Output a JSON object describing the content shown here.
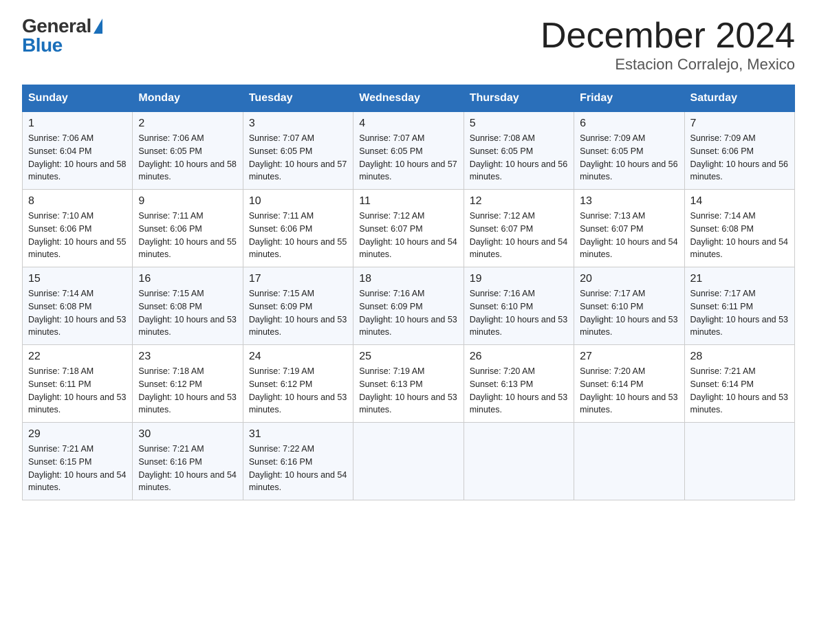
{
  "logo": {
    "general": "General",
    "blue": "Blue"
  },
  "title": "December 2024",
  "location": "Estacion Corralejo, Mexico",
  "headers": [
    "Sunday",
    "Monday",
    "Tuesday",
    "Wednesday",
    "Thursday",
    "Friday",
    "Saturday"
  ],
  "weeks": [
    [
      {
        "num": "1",
        "sunrise": "7:06 AM",
        "sunset": "6:04 PM",
        "daylight": "10 hours and 58 minutes."
      },
      {
        "num": "2",
        "sunrise": "7:06 AM",
        "sunset": "6:05 PM",
        "daylight": "10 hours and 58 minutes."
      },
      {
        "num": "3",
        "sunrise": "7:07 AM",
        "sunset": "6:05 PM",
        "daylight": "10 hours and 57 minutes."
      },
      {
        "num": "4",
        "sunrise": "7:07 AM",
        "sunset": "6:05 PM",
        "daylight": "10 hours and 57 minutes."
      },
      {
        "num": "5",
        "sunrise": "7:08 AM",
        "sunset": "6:05 PM",
        "daylight": "10 hours and 56 minutes."
      },
      {
        "num": "6",
        "sunrise": "7:09 AM",
        "sunset": "6:05 PM",
        "daylight": "10 hours and 56 minutes."
      },
      {
        "num": "7",
        "sunrise": "7:09 AM",
        "sunset": "6:06 PM",
        "daylight": "10 hours and 56 minutes."
      }
    ],
    [
      {
        "num": "8",
        "sunrise": "7:10 AM",
        "sunset": "6:06 PM",
        "daylight": "10 hours and 55 minutes."
      },
      {
        "num": "9",
        "sunrise": "7:11 AM",
        "sunset": "6:06 PM",
        "daylight": "10 hours and 55 minutes."
      },
      {
        "num": "10",
        "sunrise": "7:11 AM",
        "sunset": "6:06 PM",
        "daylight": "10 hours and 55 minutes."
      },
      {
        "num": "11",
        "sunrise": "7:12 AM",
        "sunset": "6:07 PM",
        "daylight": "10 hours and 54 minutes."
      },
      {
        "num": "12",
        "sunrise": "7:12 AM",
        "sunset": "6:07 PM",
        "daylight": "10 hours and 54 minutes."
      },
      {
        "num": "13",
        "sunrise": "7:13 AM",
        "sunset": "6:07 PM",
        "daylight": "10 hours and 54 minutes."
      },
      {
        "num": "14",
        "sunrise": "7:14 AM",
        "sunset": "6:08 PM",
        "daylight": "10 hours and 54 minutes."
      }
    ],
    [
      {
        "num": "15",
        "sunrise": "7:14 AM",
        "sunset": "6:08 PM",
        "daylight": "10 hours and 53 minutes."
      },
      {
        "num": "16",
        "sunrise": "7:15 AM",
        "sunset": "6:08 PM",
        "daylight": "10 hours and 53 minutes."
      },
      {
        "num": "17",
        "sunrise": "7:15 AM",
        "sunset": "6:09 PM",
        "daylight": "10 hours and 53 minutes."
      },
      {
        "num": "18",
        "sunrise": "7:16 AM",
        "sunset": "6:09 PM",
        "daylight": "10 hours and 53 minutes."
      },
      {
        "num": "19",
        "sunrise": "7:16 AM",
        "sunset": "6:10 PM",
        "daylight": "10 hours and 53 minutes."
      },
      {
        "num": "20",
        "sunrise": "7:17 AM",
        "sunset": "6:10 PM",
        "daylight": "10 hours and 53 minutes."
      },
      {
        "num": "21",
        "sunrise": "7:17 AM",
        "sunset": "6:11 PM",
        "daylight": "10 hours and 53 minutes."
      }
    ],
    [
      {
        "num": "22",
        "sunrise": "7:18 AM",
        "sunset": "6:11 PM",
        "daylight": "10 hours and 53 minutes."
      },
      {
        "num": "23",
        "sunrise": "7:18 AM",
        "sunset": "6:12 PM",
        "daylight": "10 hours and 53 minutes."
      },
      {
        "num": "24",
        "sunrise": "7:19 AM",
        "sunset": "6:12 PM",
        "daylight": "10 hours and 53 minutes."
      },
      {
        "num": "25",
        "sunrise": "7:19 AM",
        "sunset": "6:13 PM",
        "daylight": "10 hours and 53 minutes."
      },
      {
        "num": "26",
        "sunrise": "7:20 AM",
        "sunset": "6:13 PM",
        "daylight": "10 hours and 53 minutes."
      },
      {
        "num": "27",
        "sunrise": "7:20 AM",
        "sunset": "6:14 PM",
        "daylight": "10 hours and 53 minutes."
      },
      {
        "num": "28",
        "sunrise": "7:21 AM",
        "sunset": "6:14 PM",
        "daylight": "10 hours and 53 minutes."
      }
    ],
    [
      {
        "num": "29",
        "sunrise": "7:21 AM",
        "sunset": "6:15 PM",
        "daylight": "10 hours and 54 minutes."
      },
      {
        "num": "30",
        "sunrise": "7:21 AM",
        "sunset": "6:16 PM",
        "daylight": "10 hours and 54 minutes."
      },
      {
        "num": "31",
        "sunrise": "7:22 AM",
        "sunset": "6:16 PM",
        "daylight": "10 hours and 54 minutes."
      },
      null,
      null,
      null,
      null
    ]
  ]
}
